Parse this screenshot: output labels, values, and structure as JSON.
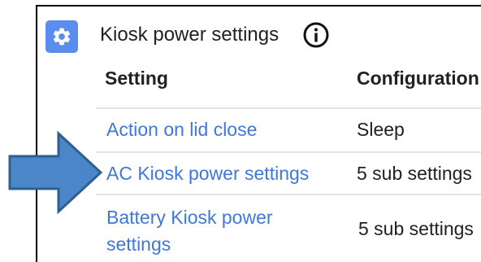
{
  "section": {
    "title": "Kiosk power settings",
    "icon": "gear-icon",
    "info_icon": "info-icon"
  },
  "table": {
    "headers": [
      "Setting",
      "Configuration"
    ],
    "rows": [
      {
        "setting": "Action on lid close",
        "configuration": "Sleep"
      },
      {
        "setting": "AC Kiosk power settings",
        "configuration": "5 sub settings"
      },
      {
        "setting": "Battery Kiosk power settings",
        "configuration": "5 sub settings"
      }
    ]
  },
  "callout": {
    "icon": "arrow-right-icon",
    "points_to_row": 1
  },
  "colors": {
    "accent": "#5b8def",
    "link": "#3f78d8",
    "arrow_fill": "#4a86c8",
    "arrow_stroke": "#2f5e93"
  }
}
